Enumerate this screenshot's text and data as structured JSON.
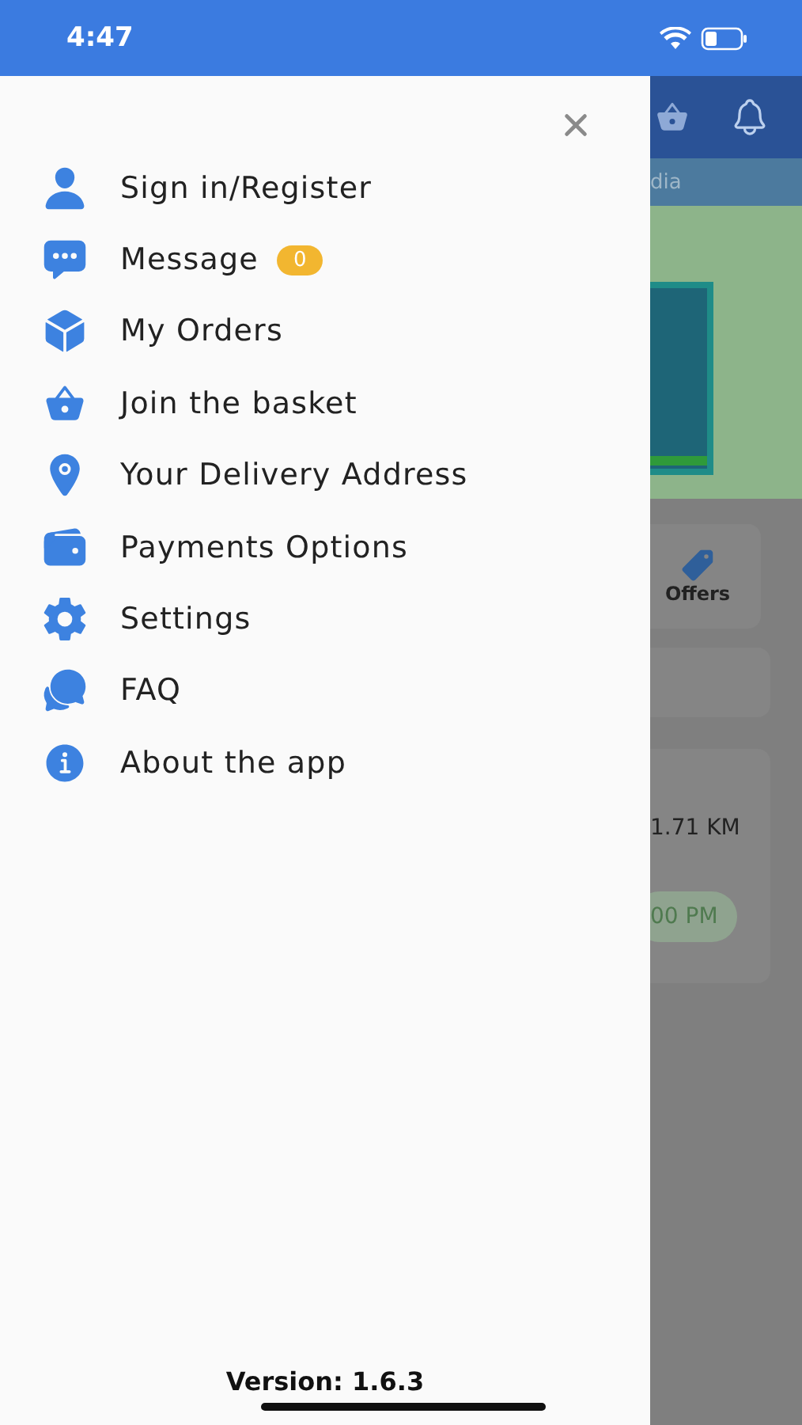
{
  "status_bar": {
    "time": "4:47"
  },
  "drawer": {
    "items": [
      {
        "label": "Sign in/Register"
      },
      {
        "label": "Message",
        "badge": "0"
      },
      {
        "label": "My Orders"
      },
      {
        "label": "Join the basket"
      },
      {
        "label": "Your Delivery Address"
      },
      {
        "label": "Payments Options"
      },
      {
        "label": "Settings"
      },
      {
        "label": "FAQ"
      },
      {
        "label": "About the app"
      }
    ],
    "version": "Version: 1.6.3"
  },
  "background": {
    "tab_text": "dia",
    "offers_label": "Offers",
    "distance": "1.71 KM",
    "time_pill": "00 PM"
  }
}
